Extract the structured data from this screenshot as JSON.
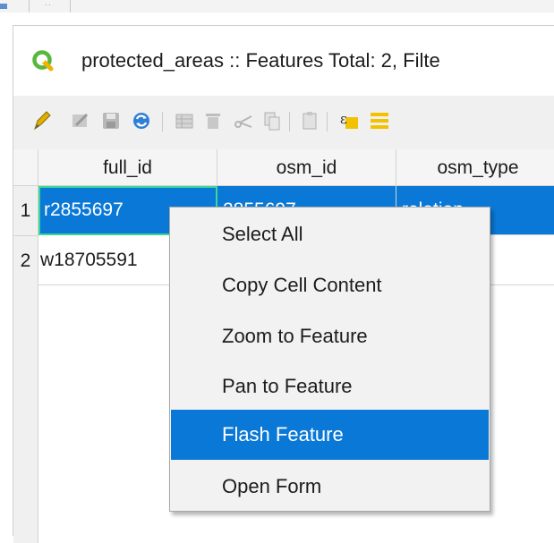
{
  "window": {
    "title": "protected_areas :: Features Total: 2, Filte",
    "icon": "qgis-logo-icon"
  },
  "toolbar": {
    "buttons": [
      {
        "name": "toggle-editing-icon"
      },
      {
        "name": "multi-edit-icon"
      },
      {
        "name": "save-edits-icon"
      },
      {
        "name": "reload-table-icon"
      },
      {
        "name": "add-feature-icon"
      },
      {
        "name": "delete-feature-icon"
      },
      {
        "name": "cut-icon"
      },
      {
        "name": "copy-icon"
      },
      {
        "name": "paste-icon"
      },
      {
        "name": "select-by-expression-icon"
      },
      {
        "name": "select-all-icon"
      }
    ]
  },
  "table": {
    "columns": [
      "full_id",
      "osm_id",
      "osm_type"
    ],
    "rows": [
      {
        "index": "1",
        "cells": [
          "r2855697",
          "2855697",
          "relation"
        ],
        "selected": true
      },
      {
        "index": "2",
        "cells": [
          "w18705591",
          "",
          ""
        ],
        "selected": false
      }
    ]
  },
  "context_menu": {
    "items": [
      {
        "label": "Select All",
        "highlighted": false
      },
      {
        "label": "Copy Cell Content",
        "highlighted": false
      },
      {
        "label": "Zoom to Feature",
        "highlighted": false
      },
      {
        "label": "Pan to Feature",
        "highlighted": false
      },
      {
        "label": "Flash Feature",
        "highlighted": true
      },
      {
        "label": "Open Form",
        "highlighted": false
      }
    ]
  },
  "colors": {
    "selection": "#0a78d6",
    "current_cell_border": "#3ed598",
    "qgis_green": "#57b83d"
  }
}
